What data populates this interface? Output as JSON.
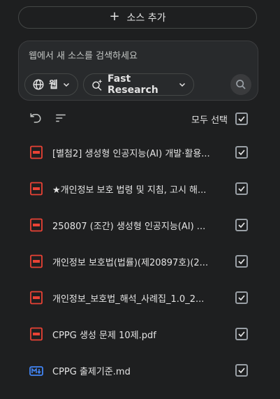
{
  "add_source": {
    "label": "소스 추가",
    "icon": "plus-icon"
  },
  "web_search": {
    "placeholder": "웹에서 새 소스를 검색하세요",
    "source_chip": {
      "label": "웹",
      "icon": "globe-icon"
    },
    "mode_chip": {
      "label": "Fast Research",
      "icon": "sparkle-search-icon"
    },
    "submit_icon": "search-icon"
  },
  "toolbar": {
    "select_all_label": "모두 선택",
    "select_all_checked": true
  },
  "sources": [
    {
      "title": "[별첨2] 생성형 인공지능(AI) 개발·활용...",
      "type": "pdf",
      "checked": true
    },
    {
      "title": "★개인정보 보호 법령 및 지침, 고시 해...",
      "type": "pdf",
      "checked": true
    },
    {
      "title": "250807 (조간) 생성형 인공지능(AI) ...",
      "type": "pdf",
      "checked": true
    },
    {
      "title": "개인정보 보호법(법률)(제20897호)(2...",
      "type": "pdf",
      "checked": true
    },
    {
      "title": "개인정보_보호법_해석_사례집_1.0_2...",
      "type": "pdf",
      "checked": true
    },
    {
      "title": "CPPG 생성 문제 10제.pdf",
      "type": "pdf",
      "checked": true
    },
    {
      "title": "CPPG 출제기준.md",
      "type": "md",
      "checked": true
    }
  ],
  "colors": {
    "background": "#1e1f20",
    "pdf_icon": "#e94235",
    "md_icon": "#4285f4",
    "text": "#e3e3e3"
  }
}
